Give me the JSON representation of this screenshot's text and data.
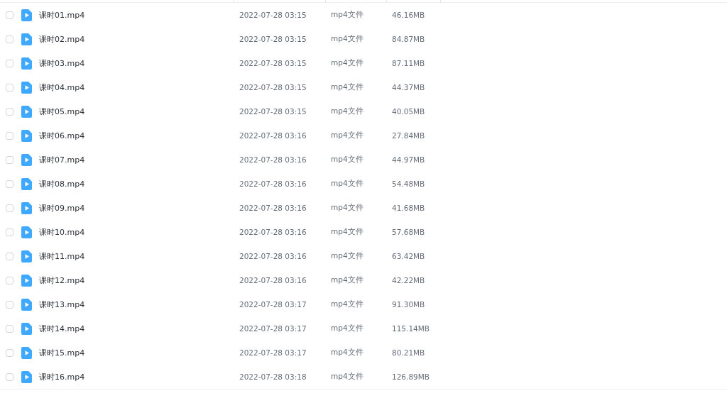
{
  "files": [
    {
      "name": "课时01.mp4",
      "modified": "2022-07-28 03:15",
      "type": "mp4文件",
      "size": "46.16MB",
      "checked": false
    },
    {
      "name": "课时02.mp4",
      "modified": "2022-07-28 03:15",
      "type": "mp4文件",
      "size": "84.87MB",
      "checked": false
    },
    {
      "name": "课时03.mp4",
      "modified": "2022-07-28 03:15",
      "type": "mp4文件",
      "size": "87.11MB",
      "checked": false
    },
    {
      "name": "课时04.mp4",
      "modified": "2022-07-28 03:15",
      "type": "mp4文件",
      "size": "44.37MB",
      "checked": false
    },
    {
      "name": "课时05.mp4",
      "modified": "2022-07-28 03:15",
      "type": "mp4文件",
      "size": "40.05MB",
      "checked": false
    },
    {
      "name": "课时06.mp4",
      "modified": "2022-07-28 03:16",
      "type": "mp4文件",
      "size": "27.84MB",
      "checked": false
    },
    {
      "name": "课时07.mp4",
      "modified": "2022-07-28 03:16",
      "type": "mp4文件",
      "size": "44.97MB",
      "checked": false
    },
    {
      "name": "课时08.mp4",
      "modified": "2022-07-28 03:16",
      "type": "mp4文件",
      "size": "54.48MB",
      "checked": false
    },
    {
      "name": "课时09.mp4",
      "modified": "2022-07-28 03:16",
      "type": "mp4文件",
      "size": "41.68MB",
      "checked": false
    },
    {
      "name": "课时10.mp4",
      "modified": "2022-07-28 03:16",
      "type": "mp4文件",
      "size": "57.68MB",
      "checked": false
    },
    {
      "name": "课时11.mp4",
      "modified": "2022-07-28 03:16",
      "type": "mp4文件",
      "size": "63.42MB",
      "checked": false
    },
    {
      "name": "课时12.mp4",
      "modified": "2022-07-28 03:16",
      "type": "mp4文件",
      "size": "42.22MB",
      "checked": false
    },
    {
      "name": "课时13.mp4",
      "modified": "2022-07-28 03:17",
      "type": "mp4文件",
      "size": "91.30MB",
      "checked": false
    },
    {
      "name": "课时14.mp4",
      "modified": "2022-07-28 03:17",
      "type": "mp4文件",
      "size": "115.14MB",
      "checked": false
    },
    {
      "name": "课时15.mp4",
      "modified": "2022-07-28 03:17",
      "type": "mp4文件",
      "size": "80.21MB",
      "checked": false
    },
    {
      "name": "课时16.mp4",
      "modified": "2022-07-28 03:18",
      "type": "mp4文件",
      "size": "126.89MB",
      "checked": false
    }
  ]
}
